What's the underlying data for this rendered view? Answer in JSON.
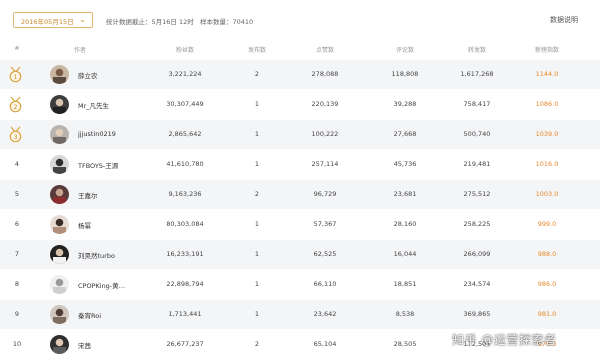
{
  "filter": {
    "date_value": "2016年05月15日",
    "chevron_icon": "chevron-down-icon"
  },
  "meta": {
    "updated_label": "统计数据截止：5月16日 12时",
    "sample_label": "样本数量：70410"
  },
  "help_label": "数据说明",
  "columns": {
    "rank": "#",
    "author": "作者",
    "fans": "粉丝数",
    "posts": "发布数",
    "likes": "点赞数",
    "comments": "评论数",
    "reposts": "转发数",
    "index": "新榜指数"
  },
  "rows": [
    {
      "rank": "1",
      "name": "薛立农",
      "fans": "3,221,224",
      "posts": "2",
      "likes": "278,088",
      "comments": "118,808",
      "reposts": "1,617,268",
      "index": "1144.0",
      "medal": "gold-medal-icon"
    },
    {
      "rank": "2",
      "name": "Mr_凡先生",
      "fans": "30,307,449",
      "posts": "1",
      "likes": "220,139",
      "comments": "39,288",
      "reposts": "758,417",
      "index": "1086.0",
      "medal": "silver-medal-icon"
    },
    {
      "rank": "3",
      "name": "jjjustin0219",
      "fans": "2,865,642",
      "posts": "1",
      "likes": "100,222",
      "comments": "27,668",
      "reposts": "500,740",
      "index": "1039.0",
      "medal": "bronze-medal-icon"
    },
    {
      "rank": "4",
      "name": "TFBOYS-王源",
      "fans": "41,610,780",
      "posts": "1",
      "likes": "257,114",
      "comments": "45,736",
      "reposts": "219,481",
      "index": "1016.0"
    },
    {
      "rank": "5",
      "name": "王嘉尔",
      "fans": "9,163,236",
      "posts": "2",
      "likes": "96,729",
      "comments": "23,681",
      "reposts": "275,512",
      "index": "1003.0"
    },
    {
      "rank": "6",
      "name": "杨幂",
      "fans": "80,303,084",
      "posts": "1",
      "likes": "57,367",
      "comments": "28,160",
      "reposts": "258,225",
      "index": "999.0"
    },
    {
      "rank": "7",
      "name": "刘昊然turbo",
      "fans": "16,233,191",
      "posts": "1",
      "likes": "62,525",
      "comments": "16,044",
      "reposts": "266,099",
      "index": "988.0"
    },
    {
      "rank": "8",
      "name": "CPOPKing-黄…",
      "fans": "22,898,794",
      "posts": "1",
      "likes": "66,110",
      "comments": "18,851",
      "reposts": "234,574",
      "index": "986.0"
    },
    {
      "rank": "9",
      "name": "秦宵Roi",
      "fans": "1,713,441",
      "posts": "1",
      "likes": "23,642",
      "comments": "8,538",
      "reposts": "369,865",
      "index": "981.0"
    },
    {
      "rank": "10",
      "name": "宋茜",
      "fans": "26,677,237",
      "posts": "2",
      "likes": "65,104",
      "comments": "28,505",
      "reposts": "172,501",
      "index": "976.0"
    }
  ],
  "watermark": "知乎 @运营探索者",
  "colors": {
    "accent": "#e8882a",
    "medal_border": "#e3b97a",
    "row_alt": "#f4f5f7"
  }
}
